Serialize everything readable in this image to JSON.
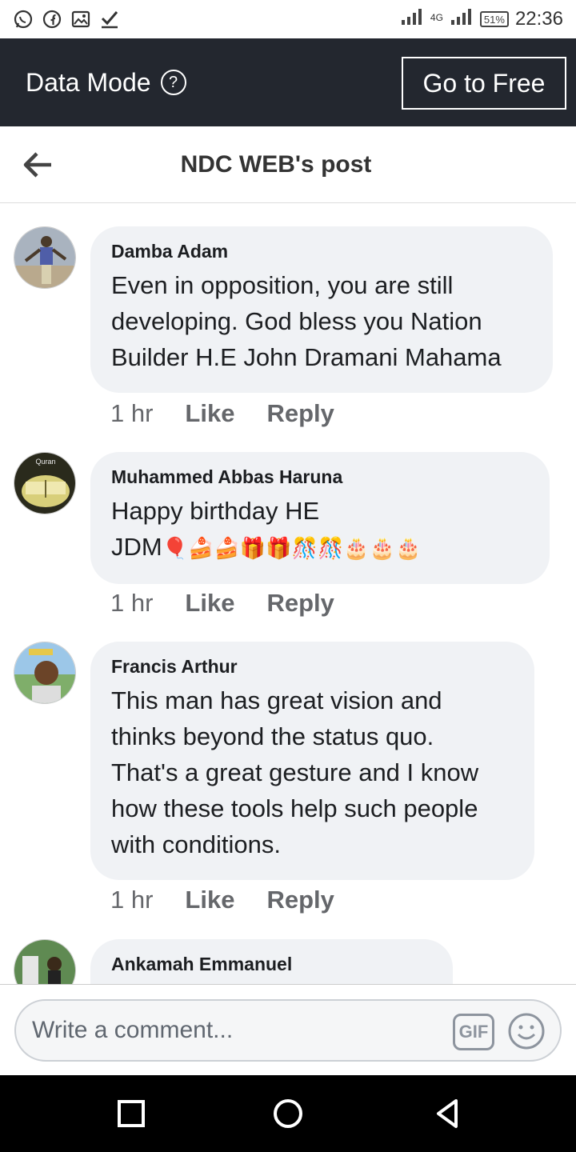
{
  "status_bar": {
    "network": "4G",
    "battery": "51%",
    "time": "22:36",
    "left_icons": [
      "whatsapp-icon",
      "facebook-icon",
      "gallery-icon",
      "checkmark-icon"
    ]
  },
  "data_mode": {
    "title": "Data Mode",
    "button": "Go to Free"
  },
  "header": {
    "title": "NDC WEB's post"
  },
  "comments": [
    {
      "name": "Damba Adam",
      "text": "Even in opposition, you are still\ndeveloping. God bless you Nation\nBuilder H.E John Dramani Mahama",
      "time": "1 hr",
      "like": "Like",
      "reply": "Reply"
    },
    {
      "name": "Muhammed Abbas Haruna",
      "text": "Happy birthday HE\nJDM",
      "emojis": "🎈🍰🍰🎁🎁🎊🎊🎂🎂🎂",
      "avatar_text": "Quran",
      "time": "1 hr",
      "like": "Like",
      "reply": "Reply"
    },
    {
      "name": "Francis Arthur",
      "text": "This man has great vision and\nthinks beyond the status quo.\nThat's a great gesture and I know\nhow these tools help such people\nwith conditions.",
      "time": "1 hr",
      "like": "Like",
      "reply": "Reply"
    },
    {
      "name": "Ankamah Emmanuel",
      "text": ""
    }
  ],
  "composer": {
    "placeholder": "Write a comment...",
    "gif": "GIF"
  },
  "colors": {
    "data_bar": "#23272f",
    "bubble": "#f0f2f5",
    "meta_text": "#65676b"
  }
}
